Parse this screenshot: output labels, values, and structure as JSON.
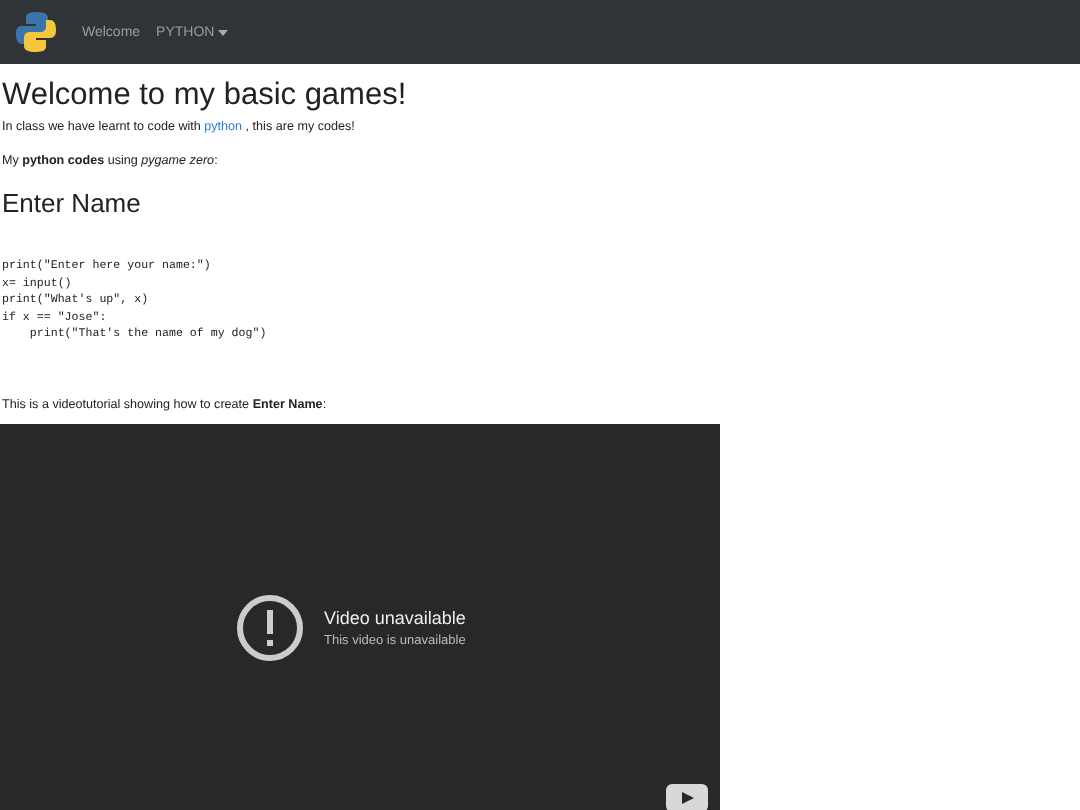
{
  "navbar": {
    "items": [
      {
        "label": "Welcome",
        "kind": "link"
      },
      {
        "label": "PYTHON",
        "kind": "dropdown"
      }
    ]
  },
  "title": "Welcome to my basic games!",
  "intro": {
    "before": "In class we have learnt to code with",
    "link": "python",
    "after": ", this are my codes!"
  },
  "subtitle": "My **python codes** using *pygame zero*:",
  "section_title": "Enter Name",
  "code": [
    "print(\"Enter here your name:\")",
    "x= input()",
    "print(\"What's up\", x)",
    "if x == \"Jose\":",
    "    print(\"That's the name of my dog\")"
  ],
  "video_caption": "This is a videotutorial showing how to create **Enter Name**:",
  "video": {
    "title": "Video unavailable",
    "message": "This video is unavailable"
  }
}
